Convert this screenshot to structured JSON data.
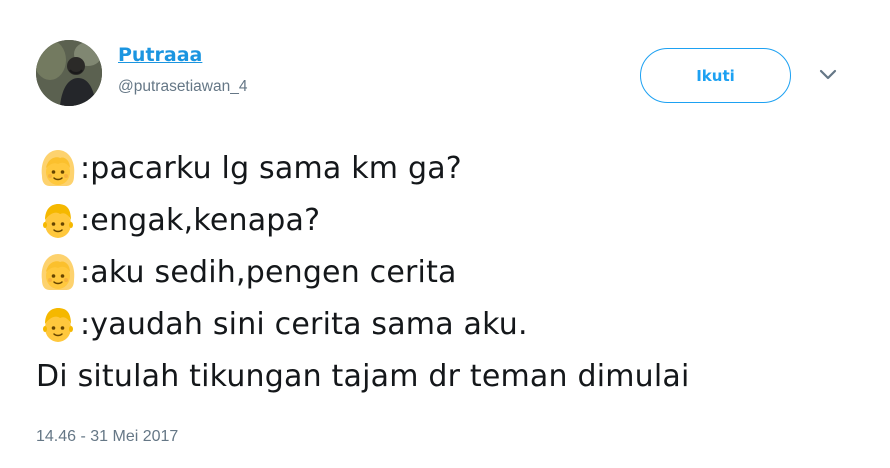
{
  "user": {
    "display_name": "Putraaa",
    "handle": "@putrasetiawan_4"
  },
  "follow_button": {
    "label": "Ikuti"
  },
  "tweet": {
    "lines": [
      {
        "emoji": "girl-emoji",
        "text": ":pacarku lg sama km ga?"
      },
      {
        "emoji": "boy-emoji",
        "text": ":engak,kenapa?"
      },
      {
        "emoji": "girl-emoji",
        "text": ":aku sedih,pengen cerita"
      },
      {
        "emoji": "boy-emoji",
        "text": ":yaudah sini cerita sama aku."
      },
      {
        "emoji": "",
        "text": "Di situlah tikungan tajam dr teman dimulai"
      }
    ],
    "timestamp": "14.46 - 31 Mei 2017"
  },
  "colors": {
    "link_blue": "#1b95e0",
    "button_blue": "#1da1f2",
    "muted_gray": "#657786",
    "text_dark": "#14171a"
  },
  "icons": {
    "caret": "chevron-down-icon",
    "avatar": "profile-photo"
  }
}
